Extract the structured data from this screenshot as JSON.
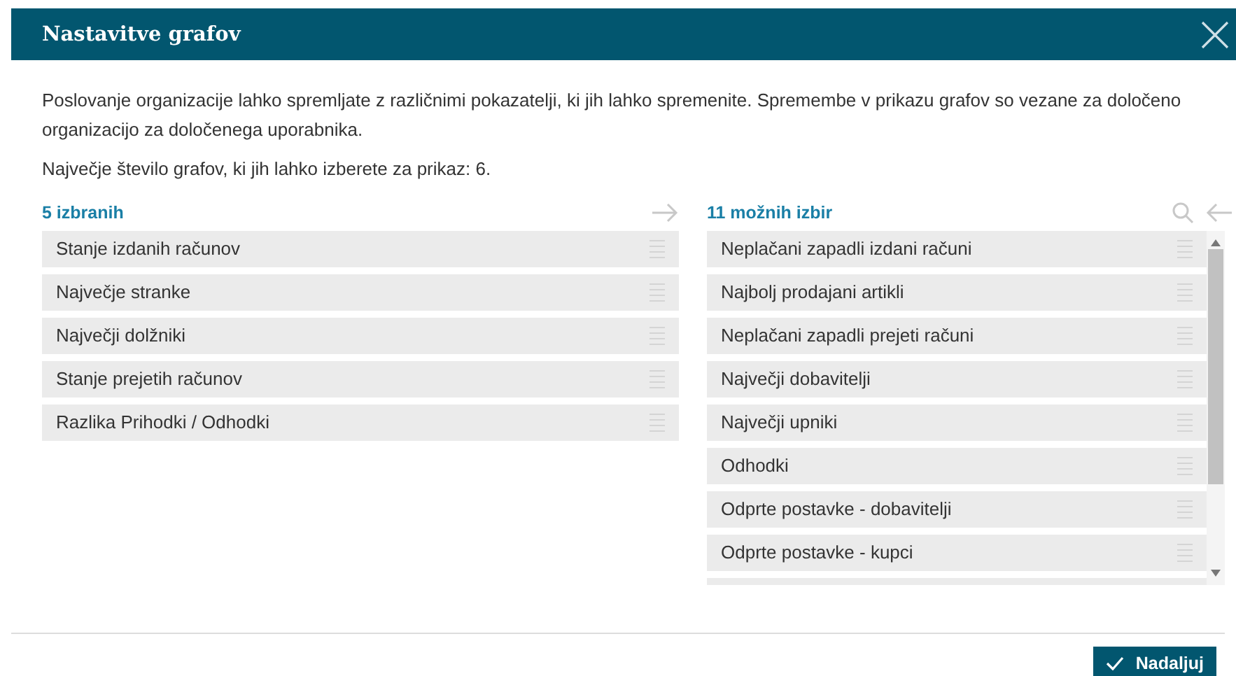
{
  "dialog": {
    "title": "Nastavitve grafov",
    "intro": "Poslovanje organizacije lahko spremljate z različnimi pokazatelji, ki jih lahko spremenite. Spremembe v prikazu grafov so vezane za določeno organizacijo za določenega uporabnika.",
    "limit_note": "Največje število grafov, ki jih lahko izberete za prikaz: 6."
  },
  "selected_list": {
    "heading": "5 izbranih",
    "items": [
      {
        "label": "Stanje izdanih računov"
      },
      {
        "label": "Največje stranke"
      },
      {
        "label": "Največji dolžniki"
      },
      {
        "label": "Stanje prejetih računov"
      },
      {
        "label": "Razlika Prihodki / Odhodki"
      }
    ]
  },
  "available_list": {
    "heading": "11 možnih izbir",
    "items": [
      {
        "label": "Neplačani zapadli izdani računi"
      },
      {
        "label": "Najbolj prodajani artikli"
      },
      {
        "label": "Neplačani zapadli prejeti računi"
      },
      {
        "label": "Največji dobavitelji"
      },
      {
        "label": "Največji upniki"
      },
      {
        "label": "Odhodki"
      },
      {
        "label": "Odprte postavke - dobavitelji"
      },
      {
        "label": "Odprte postavke - kupci"
      }
    ]
  },
  "buttons": [
    {
      "label": "Nadaljuj",
      "kind": "primary"
    }
  ]
}
